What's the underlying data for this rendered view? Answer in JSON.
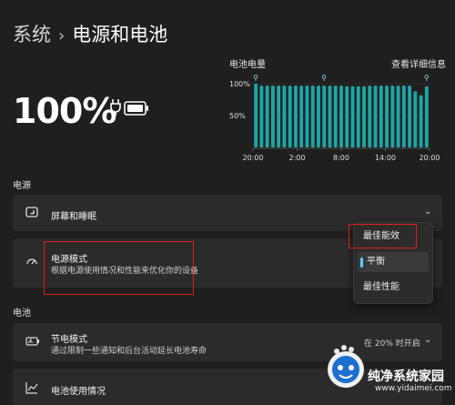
{
  "breadcrumb": {
    "parent": "系统",
    "separator": "›",
    "current": "电源和电池"
  },
  "battery": {
    "percentage": "100%"
  },
  "chart_data": {
    "type": "bar",
    "title": "电池电量",
    "link": "查看详细信息",
    "x_ticks": [
      "20:00",
      "2:00",
      "8:00",
      "14:00",
      "20:00"
    ],
    "y_ticks": [
      "100%",
      "50%"
    ],
    "ylim": [
      0,
      100
    ],
    "values": [
      100,
      97,
      97,
      97,
      97,
      97,
      97,
      97,
      97,
      97,
      97,
      97,
      97,
      97,
      97,
      97,
      96,
      96,
      96,
      96,
      97,
      97,
      97,
      97,
      97,
      97,
      97,
      97,
      88,
      82,
      96
    ],
    "charging_marks": [
      0,
      12,
      30
    ],
    "color": "#1ea6a6"
  },
  "sections": {
    "power": "电源",
    "battery": "电池"
  },
  "cards": {
    "screen_sleep": {
      "label": "屏幕和睡眠"
    },
    "power_mode": {
      "label": "电源模式",
      "description": "根据电源使用情况和性能来优化你的设备"
    },
    "battery_saver": {
      "label": "节电模式",
      "description": "通过限制一些通知和后台活动延长电池寿命",
      "value": "在 20% 时开启"
    },
    "battery_usage": {
      "label": "电池使用情况"
    }
  },
  "dropdown": {
    "options": [
      "最佳能效",
      "平衡",
      "最佳性能"
    ],
    "selected": "平衡"
  },
  "watermark": {
    "title": "纯净系统家园",
    "url": "www.yidaimei.com"
  },
  "colors": {
    "accent": "#60cdff",
    "highlight_box": "#e01e1e",
    "chart": "#1ea6a6"
  }
}
